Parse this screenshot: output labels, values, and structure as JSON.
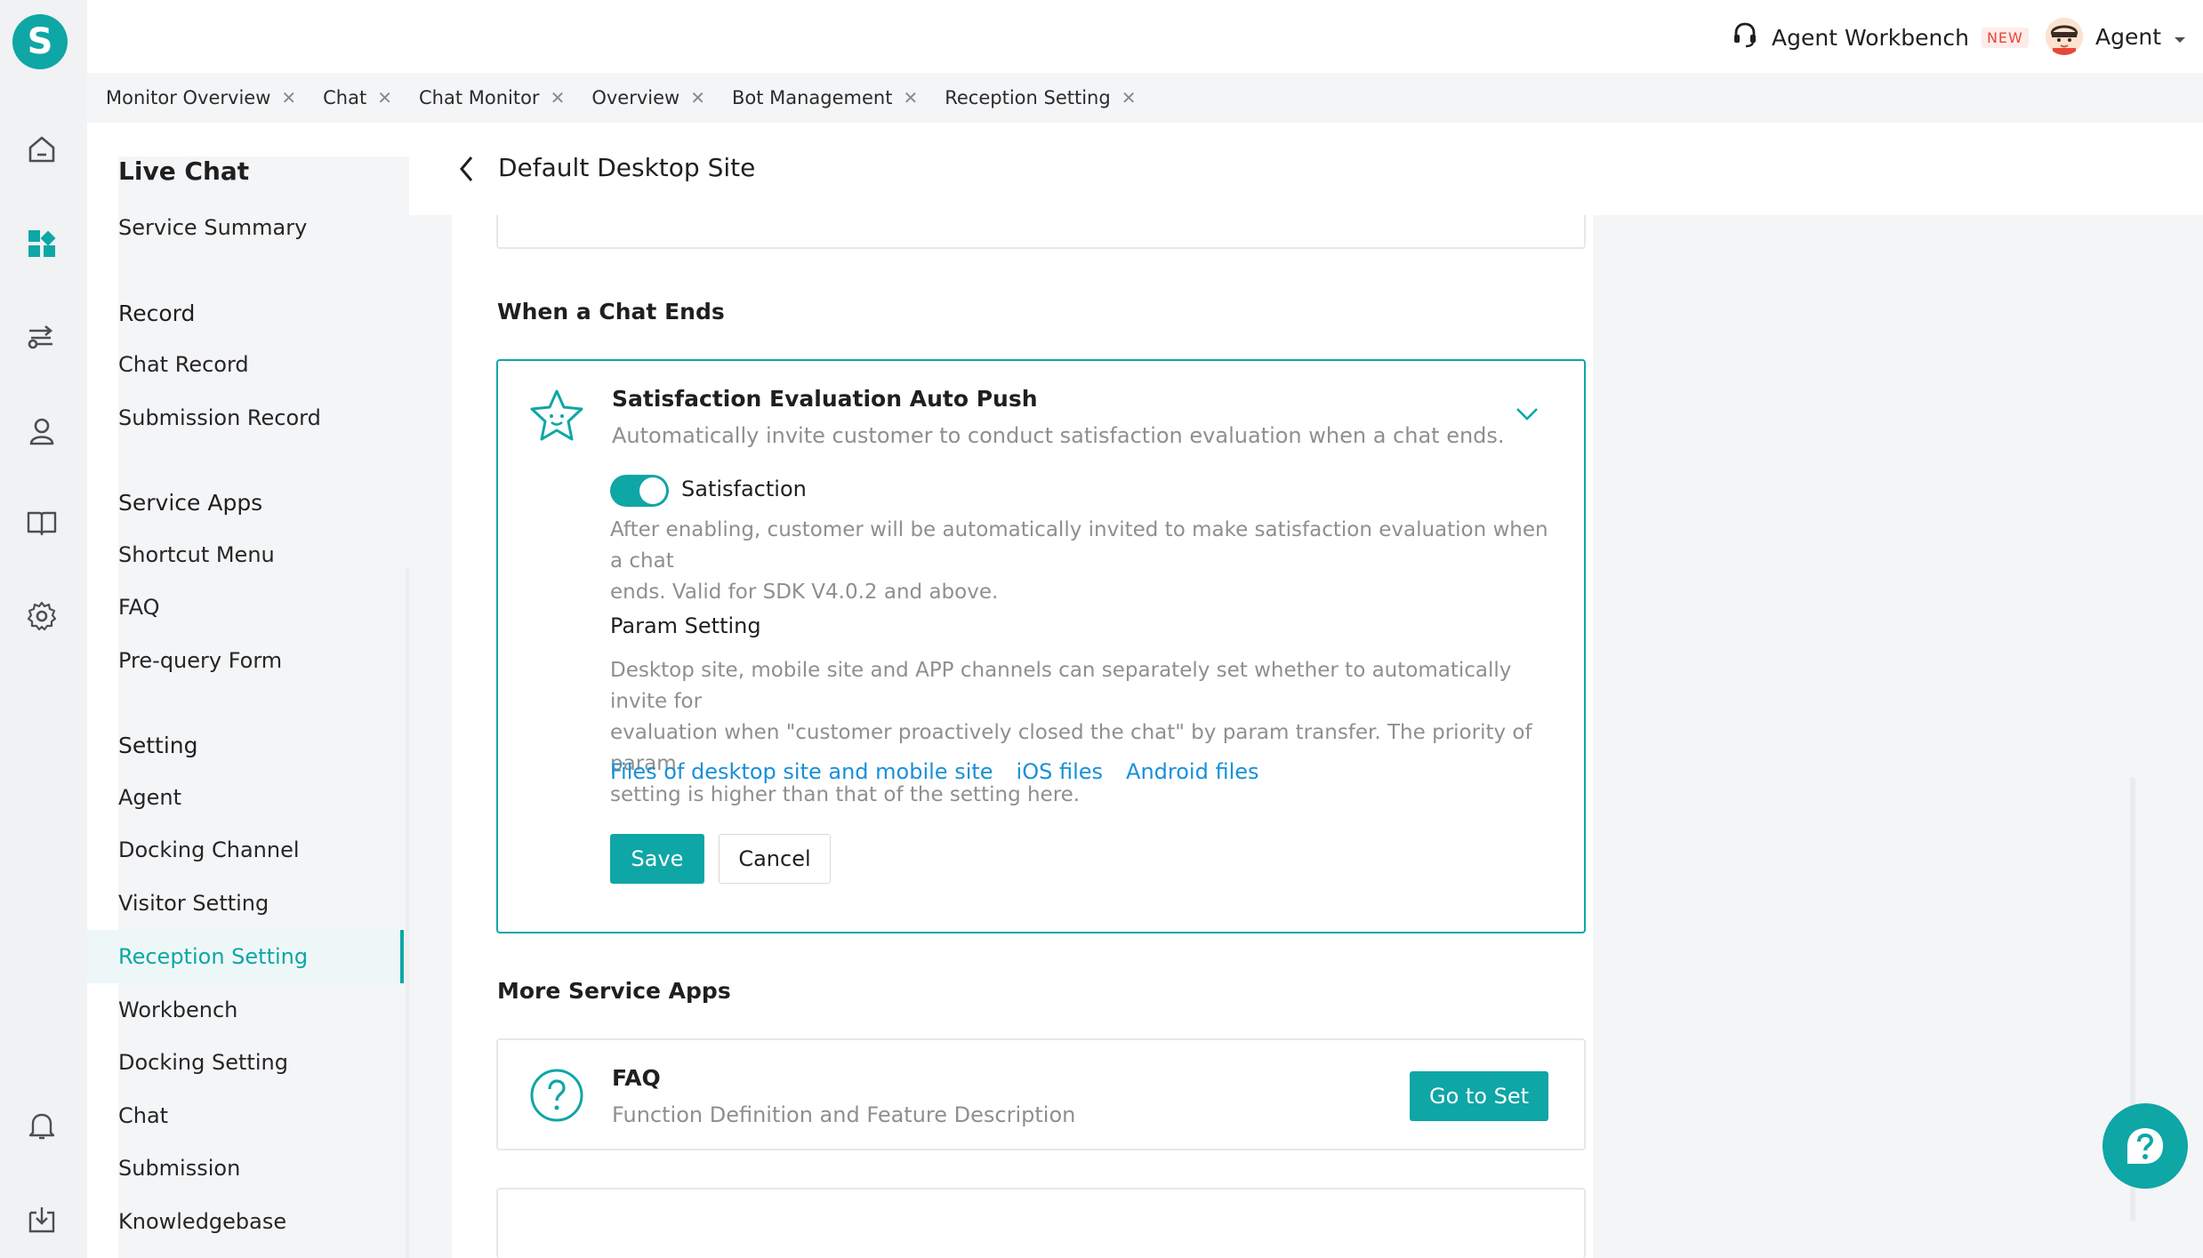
{
  "rail": {
    "logo_letter": "S",
    "icons": [
      "home-icon",
      "apps-icon",
      "routing-icon",
      "user-group-icon",
      "book-icon",
      "settings-icon",
      "bell-icon",
      "download-icon"
    ]
  },
  "topbar": {
    "workbench_label": "Agent Workbench",
    "new_badge": "NEW",
    "agent_label": "Agent"
  },
  "tabs": [
    {
      "label": "Monitor Overview"
    },
    {
      "label": "Chat"
    },
    {
      "label": "Chat Monitor"
    },
    {
      "label": "Overview"
    },
    {
      "label": "Bot Management"
    },
    {
      "label": "Reception Setting"
    }
  ],
  "sidebar": {
    "title": "Live Chat",
    "service_summary": "Service Summary",
    "groups": [
      {
        "title": "Record",
        "items": [
          "Chat Record",
          "Submission Record"
        ]
      },
      {
        "title": "Service Apps",
        "items": [
          "Shortcut Menu",
          "FAQ",
          "Pre-query Form"
        ]
      },
      {
        "title": "Setting",
        "items": [
          "Agent",
          "Docking Channel",
          "Visitor Setting",
          "Reception Setting",
          "Workbench",
          "Docking Setting",
          "Chat",
          "Submission",
          "Knowledgebase"
        ]
      }
    ],
    "active_item": "Reception Setting"
  },
  "page": {
    "title": "Default Desktop Site",
    "section_chat_ends": "When a Chat Ends",
    "satisfaction_card": {
      "title": "Satisfaction Evaluation Auto Push",
      "desc": "Automatically invite customer to conduct satisfaction evaluation when a chat ends.",
      "toggle_label": "Satisfaction",
      "toggle_on": true,
      "toggle_desc_1": "After enabling, customer will be automatically invited to make satisfaction evaluation when a chat",
      "toggle_desc_2": "ends. Valid for SDK V4.0.2 and above.",
      "param_title": "Param Setting",
      "param_desc_1": "Desktop site, mobile site and APP channels can separately set whether to automatically invite for",
      "param_desc_2": "evaluation when \"customer proactively closed the chat\" by param transfer. The priority of param",
      "param_desc_3": "setting is higher than that of the setting here.",
      "links": [
        "Files of desktop site and mobile site",
        "iOS files",
        "Android files"
      ],
      "save_label": "Save",
      "cancel_label": "Cancel"
    },
    "section_more_apps": "More Service Apps",
    "faq_card": {
      "title": "FAQ",
      "desc": "Function Definition and Feature Description",
      "button_label": "Go to Set"
    }
  },
  "colors": {
    "accent": "#0fa6a6",
    "link": "#1890d9",
    "badge_red": "#e8473a"
  }
}
